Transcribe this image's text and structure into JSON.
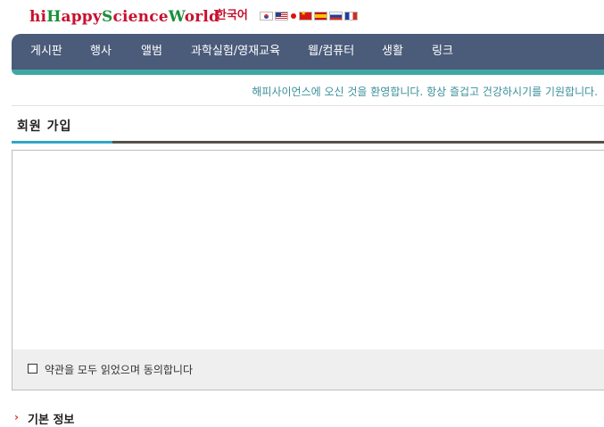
{
  "header": {
    "logo_parts": [
      {
        "text": "hi",
        "color": "red"
      },
      {
        "text": "H",
        "color": "green"
      },
      {
        "text": "appy",
        "color": "red"
      },
      {
        "text": "S",
        "color": "green"
      },
      {
        "text": "cience",
        "color": "red"
      },
      {
        "text": "W",
        "color": "green"
      },
      {
        "text": "orld",
        "color": "red"
      }
    ],
    "language": "한국어",
    "flags": [
      "korea-flag-icon",
      "usa-flag-icon",
      "japan-flag-icon",
      "china-flag-icon",
      "spain-flag-icon",
      "russia-flag-icon",
      "france-flag-icon"
    ]
  },
  "nav": {
    "items": [
      "게시판",
      "행사",
      "앨범",
      "과학실험/영재교육",
      "웹/컴퓨터",
      "생활",
      "링크"
    ]
  },
  "welcome_text": "해피사이언스에 오신 것을 환영합니다. 항상 즐겁고 건강하시기를 기원합니다.",
  "page_title": "회원 가입",
  "terms": {
    "agree_label": "약관을 모두 읽었으며 동의합니다",
    "checked": false
  },
  "section": {
    "title": "기본 정보"
  },
  "colors": {
    "nav_bg": "#4b5b7a",
    "nav_accent": "#3fa7a4",
    "logo_red": "#c8102e",
    "logo_green": "#1a8f3a",
    "title_underline": "#2fa6c8"
  }
}
